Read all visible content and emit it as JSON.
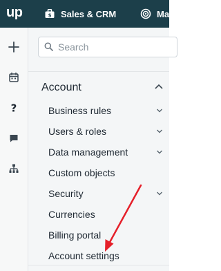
{
  "topbar": {
    "brand": "up",
    "tabs": [
      {
        "label": "Sales & CRM",
        "icon": "briefcase-icon"
      },
      {
        "label": "Ma",
        "icon": "target-icon"
      }
    ]
  },
  "sidebar": {
    "buttons": [
      {
        "icon": "plus-icon"
      },
      {
        "icon": "calendar-icon"
      },
      {
        "icon": "help-icon"
      },
      {
        "icon": "chat-icon"
      },
      {
        "icon": "sitemap-icon"
      }
    ]
  },
  "search": {
    "placeholder": "Search"
  },
  "section": {
    "title": "Account"
  },
  "nav": {
    "items": [
      {
        "label": "Business rules"
      },
      {
        "label": "Users & roles"
      },
      {
        "label": "Data management"
      },
      {
        "label": "Custom objects"
      },
      {
        "label": "Security"
      },
      {
        "label": "Currencies"
      },
      {
        "label": "Billing portal"
      },
      {
        "label": "Account settings"
      }
    ]
  },
  "colors": {
    "topbar": "#1c3f4a",
    "annotation": "#e5202a"
  }
}
